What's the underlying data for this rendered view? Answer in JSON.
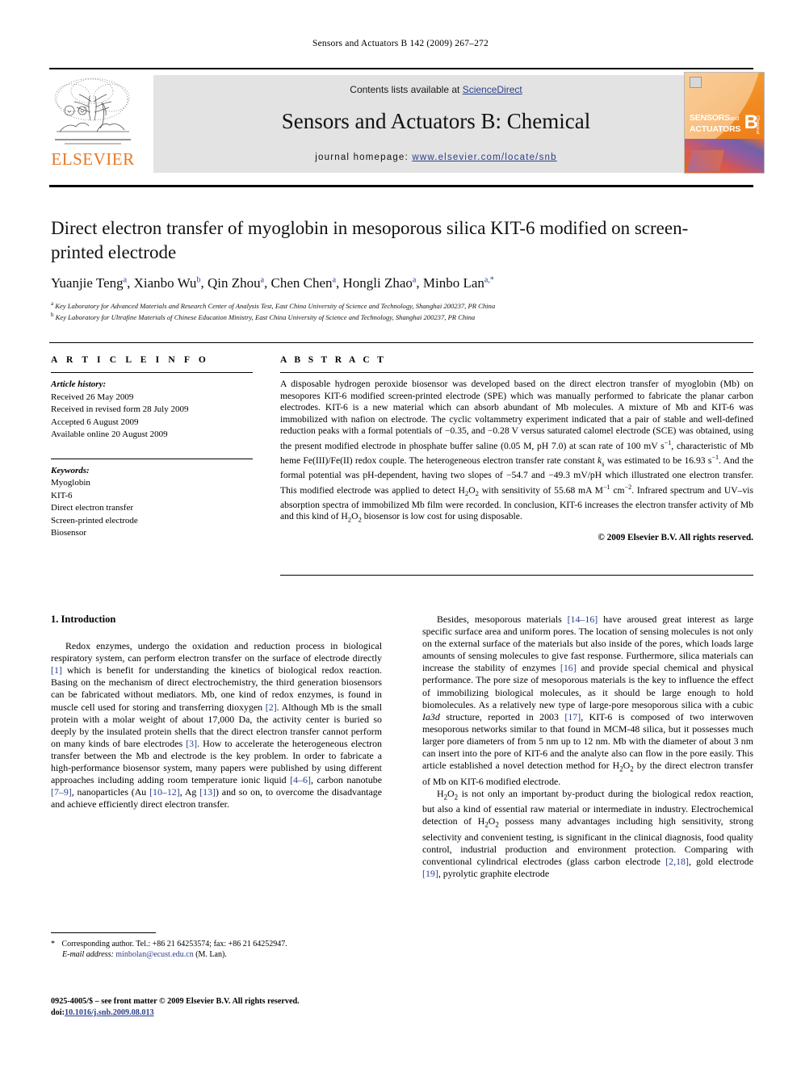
{
  "running_head": "Sensors and Actuators B 142 (2009) 267–272",
  "masthead": {
    "contents_prefix": "Contents lists available at ",
    "sciencedirect": "ScienceDirect",
    "journal_title": "Sensors and Actuators B: Chemical",
    "homepage_prefix": "journal homepage: ",
    "homepage_url": "www.elsevier.com/locate/snb",
    "publisher_logo_text": "ELSEVIER",
    "cover": {
      "line1": "SENSORS",
      "and": "and",
      "line2": "ACTUATORS",
      "letter": "B",
      "sub": "Chemical"
    },
    "colors": {
      "link": "#2b3f8c",
      "elsevier_orange": "#e87722",
      "panel_grey": "#e3e3e3"
    }
  },
  "article": {
    "title": "Direct electron transfer of myoglobin in mesoporous silica KIT-6 modified on screen-printed electrode",
    "authors_html": "Yuanjie Teng<sup>a</sup>, Xianbo Wu<sup>b</sup>, Qin Zhou<sup>a</sup>, Chen Chen<sup>a</sup>, Hongli Zhao<sup>a</sup>, Minbo Lan<sup>a,*</sup>",
    "affiliation_a": "Key Laboratory for Advanced Materials and Research Center of Analysis Test, East China University of Science and Technology, Shanghai 200237, PR China",
    "affiliation_b": "Key Laboratory for Ultrafine Materials of Chinese Education Ministry, East China University of Science and Technology, Shanghai 200237, PR China"
  },
  "info": {
    "heading": "A R T I C L E    I N F O",
    "history_label": "Article history:",
    "history": [
      "Received 26 May 2009",
      "Received in revised form 28 July 2009",
      "Accepted 6 August 2009",
      "Available online 20 August 2009"
    ],
    "keywords_label": "Keywords:",
    "keywords": [
      "Myoglobin",
      "KIT-6",
      "Direct electron transfer",
      "Screen-printed electrode",
      "Biosensor"
    ]
  },
  "abstract": {
    "heading": "A B S T R A C T",
    "body_html": "A disposable hydrogen peroxide biosensor was developed based on the direct electron transfer of myoglobin (Mb) on mesopores KIT-6 modified screen-printed electrode (SPE) which was manually performed to fabricate the planar carbon electrodes. KIT-6 is a new material which can absorb abundant of Mb molecules. A mixture of Mb and KIT-6 was immobilized with nafion on electrode. The cyclic voltammetry experiment indicated that a pair of stable and well-defined reduction peaks with a formal potentials of −0.35, and −0.28 V versus saturated calomel electrode (SCE) was obtained, using the present modified electrode in phosphate buffer saline (0.05 M, pH 7.0) at scan rate of 100 mV s<sup>−1</sup>, characteristic of Mb heme Fe(III)/Fe(II) redox couple. The heterogeneous electron transfer rate constant <span class=\"ital\">k<sub>s</sub></span> was estimated to be 16.93 s<sup>−1</sup>. And the formal potential was pH-dependent, having two slopes of −54.7 and −49.3 mV/pH which illustrated one electron transfer. This modified electrode was applied to detect H<sub>2</sub>O<sub>2</sub> with sensitivity of 55.68 mA M<sup>−1</sup> cm<sup>−2</sup>. Infrared spectrum and UV–vis absorption spectra of immobilized Mb film were recorded. In conclusion, KIT-6 increases the electron transfer activity of Mb and this kind of H<sub>2</sub>O<sub>2</sub> biosensor is low cost for using disposable.",
    "copyright": "© 2009 Elsevier B.V. All rights reserved."
  },
  "introduction": {
    "heading": "1.  Introduction",
    "para_1_html": "Redox enzymes, undergo the oxidation and reduction process in biological respiratory system, can perform electron transfer on the surface of electrode directly <span class=\"ref\">[1]</span> which is benefit for understanding the kinetics of biological redox reaction. Basing on the mechanism of direct electrochemistry, the third generation biosensors can be fabricated without mediators. Mb, one kind of redox enzymes, is found in muscle cell used for storing and transferring dioxygen <span class=\"ref\">[2]</span>. Although Mb is the small protein with a molar weight of about 17,000 Da, the activity center is buried so deeply by the insulated protein shells that the direct electron transfer cannot perform on many kinds of bare electrodes <span class=\"ref\">[3]</span>. How to accelerate the heterogeneous electron transfer between the Mb and electrode is the key problem. In order to fabricate a high-performance biosensor system, many papers were published by using different approaches including adding room temperature ionic liquid <span class=\"ref\">[4–6]</span>, carbon nanotube <span class=\"ref\">[7–9]</span>, nanoparticles (Au <span class=\"ref\">[10–12]</span>, Ag <span class=\"ref\">[13]</span>) and so on, to overcome the disadvantage and achieve efficiently direct electron transfer.",
    "para_2_html": "Besides, mesoporous materials <span class=\"ref\">[14–16]</span> have aroused great interest as large specific surface area and uniform pores. The location of sensing molecules is not only on the external surface of the materials but also inside of the pores, which loads large amounts of sensing molecules to give fast response. Furthermore, silica materials can increase the stability of enzymes <span class=\"ref\">[16]</span> and provide special chemical and physical performance. The pore size of mesoporous materials is the key to influence the effect of immobilizing biological molecules, as it should be large enough to hold biomolecules. As a relatively new type of large-pore mesoporous silica with a cubic <span class=\"ital\">Ia3d</span> structure, reported in 2003 <span class=\"ref\">[17]</span>, KIT-6 is composed of two interwoven mesoporous networks similar to that found in MCM-48 silica, but it possesses much larger pore diameters of from 5 nm up to 12 nm. Mb with the diameter of about 3 nm can insert into the pore of KIT-6 and the analyte also can flow in the pore easily. This article established a novel detection method for H<sub>2</sub>O<sub>2</sub> by the direct electron transfer of Mb on KIT-6 modified electrode.",
    "para_3_html": "H<sub>2</sub>O<sub>2</sub> is not only an important by-product during the biological redox reaction, but also a kind of essential raw material or intermediate in industry. Electrochemical detection of H<sub>2</sub>O<sub>2</sub> possess many advantages including high sensitivity, strong selectivity and convenient testing, is significant in the clinical diagnosis, food quality control, industrial production and environment protection. Comparing with conventional cylindrical electrodes (glass carbon electrode <span class=\"ref\">[2,18]</span>, gold electrode <span class=\"ref\">[19]</span>, pyrolytic graphite electrode"
  },
  "footnotes": {
    "corresponding_html": "<span class=\"star\">*</span> Corresponding author. Tel.: +86 21 64253574; fax: +86 21 64252947.",
    "email_html": "<span class=\"ital\">E-mail address:</span> <span class=\"mail-link\">minbolan@ecust.edu.cn</span> (M. Lan).",
    "imprint_html": "0925-4005/$ – see front matter © 2009 Elsevier B.V. All rights reserved.",
    "doi_label": "doi:",
    "doi_value": "10.1016/j.snb.2009.08.013"
  }
}
